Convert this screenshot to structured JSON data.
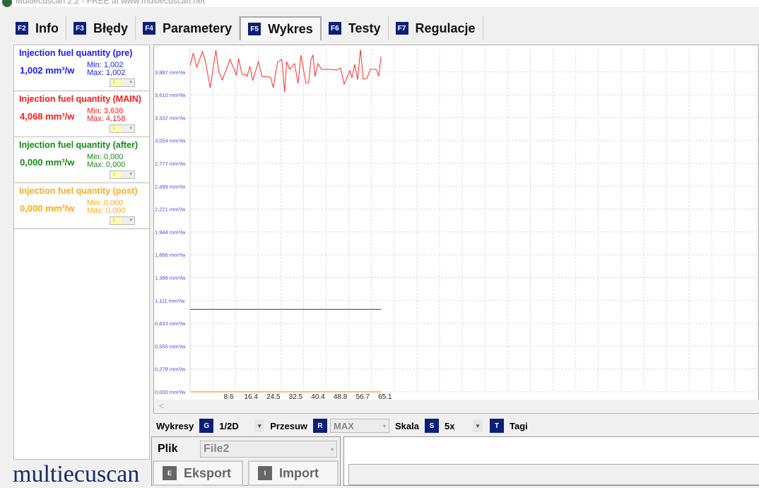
{
  "window": {
    "title": "Multiecuscan 2.2 - FREE at www.multiecuscan.net"
  },
  "tabs": [
    {
      "key": "F2",
      "label": "Info"
    },
    {
      "key": "F3",
      "label": "Błędy"
    },
    {
      "key": "F4",
      "label": "Parametery"
    },
    {
      "key": "F5",
      "label": "Wykres",
      "active": true
    },
    {
      "key": "F6",
      "label": "Testy"
    },
    {
      "key": "F7",
      "label": "Regulacje"
    }
  ],
  "params": [
    {
      "name": "Injection fuel quantity (pre)",
      "value": "1,002 mm³/w",
      "min": "Min: 1,002",
      "max": "Max: 1,002",
      "scale": "1",
      "color": "#1a1aff"
    },
    {
      "name": "Injection fuel quantity (MAIN)",
      "value": "4,068 mm³/w",
      "min": "Min: 3,636",
      "max": "Max: 4,158",
      "scale": "1",
      "color": "#ff1a1a"
    },
    {
      "name": "Injection fuel quantity (after)",
      "value": "0,000 mm³/w",
      "min": "Min: 0,000",
      "max": "Max: 0,000",
      "scale": "1",
      "color": "#168a16"
    },
    {
      "name": "Injection fuel quantity (post)",
      "value": "0,000 mm³/w",
      "min": "Min: 0,000",
      "max": "Max: 0,000",
      "scale": "1",
      "color": "#ffaa1a"
    }
  ],
  "chart_data": {
    "type": "line",
    "ylim": [
      0,
      4.168
    ],
    "xlim": [
      0,
      200
    ],
    "y_ticks": [
      "0,000 mm³/w",
      "0,278 mm³/w",
      "0,555 mm³/w",
      "0,833 mm³/w",
      "1,111 mm³/w",
      "1,388 mm³/w",
      "1,666 mm³/w",
      "1,944 mm³/w",
      "2,221 mm³/w",
      "2,499 mm³/w",
      "2,777 mm³/w",
      "3,054 mm³/w",
      "3,332 mm³/w",
      "3,610 mm³/w",
      "3,887 mm³/w"
    ],
    "x_ticks": [
      "8,6",
      "16,4",
      "24,5",
      "32,5",
      "40,4",
      "48,8",
      "56,7",
      "65,1"
    ],
    "grid": true,
    "series": [
      {
        "name": "Injection fuel quantity (pre)",
        "color": "#2a2aa8",
        "x": [
          0,
          67.35
        ],
        "y": [
          1.002,
          1.002
        ]
      },
      {
        "name": "Injection fuel quantity (MAIN)",
        "color": "#ff2a2a",
        "x": [
          0.1,
          1.1,
          2.35,
          4.35,
          5.35,
          7.1,
          9.1,
          10.1,
          11.35,
          14.1,
          16.35,
          17.1,
          18.35,
          19.85,
          20.1,
          21.1,
          22.1,
          24.1,
          25.35,
          28.35,
          29.35,
          30.85,
          32.35,
          33.35,
          34.1,
          35.1,
          36.85,
          38.1,
          39.1,
          40.85,
          41.85,
          42.6,
          43.35,
          44.1,
          45.1,
          46.35,
          49.1,
          51.85,
          53.1,
          54.35,
          56.35,
          57.1,
          58.1,
          59.1,
          60.1,
          61.1,
          62.35,
          63.6,
          65.6,
          66.6,
          67.35
        ],
        "y": [
          3.97,
          4.117,
          3.945,
          4.134,
          4.022,
          3.695,
          4.151,
          3.893,
          3.79,
          4.039,
          3.85,
          4.048,
          3.859,
          3.85,
          3.833,
          3.953,
          3.781,
          4.013,
          3.833,
          3.824,
          3.695,
          4.005,
          4.039,
          3.644,
          4.013,
          3.919,
          3.988,
          3.747,
          4.091,
          3.756,
          3.756,
          4.031,
          4.091,
          3.833,
          3.988,
          3.919,
          3.919,
          3.91,
          3.936,
          3.738,
          3.902,
          3.816,
          3.979,
          3.79,
          4.158,
          3.799,
          3.807,
          3.919,
          3.919,
          3.841,
          4.074
        ]
      },
      {
        "name": "Injection fuel quantity (after)",
        "color": "#168a16",
        "x": [
          0,
          67.35
        ],
        "y": [
          0,
          0
        ]
      },
      {
        "name": "Injection fuel quantity (post)",
        "color": "#ffc070",
        "x": [
          0,
          67.35
        ],
        "y": [
          0,
          0
        ]
      }
    ]
  },
  "toolbar": {
    "wykresy_label": "Wykresy",
    "wykresy_key": "G",
    "wykresy_value": "1/2D",
    "przesuw_label": "Przesuw",
    "przesuw_key": "R",
    "przesuw_value": "MAX",
    "skala_label": "Skala",
    "skala_key": "S",
    "skala_value": "5x",
    "tagi_key": "T",
    "tagi_label": "Tagi"
  },
  "file": {
    "label": "Plik",
    "value": "File2",
    "export_key": "E",
    "export_label": "Eksport",
    "import_key": "I",
    "import_label": "Import"
  },
  "logo": "multiecuscan"
}
